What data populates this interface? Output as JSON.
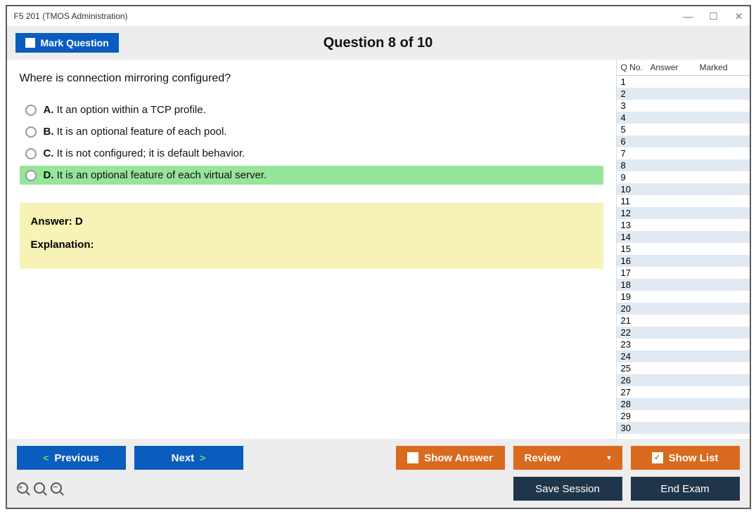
{
  "window": {
    "title": "F5 201 (TMOS Administration)"
  },
  "topbar": {
    "mark_label": "Mark Question",
    "question_title": "Question 8 of 10"
  },
  "question": {
    "text": "Where is connection mirroring configured?",
    "options": [
      {
        "letter": "A.",
        "text": "It an option within a TCP profile.",
        "correct": false
      },
      {
        "letter": "B.",
        "text": "It is an optional feature of each pool.",
        "correct": false
      },
      {
        "letter": "C.",
        "text": "It is not configured; it is default behavior.",
        "correct": false
      },
      {
        "letter": "D.",
        "text": "It is an optional feature of each virtual server.",
        "correct": true
      }
    ]
  },
  "answer_box": {
    "answer_label": "Answer: D",
    "explanation_label": "Explanation:"
  },
  "side_panel": {
    "headers": {
      "qno": "Q No.",
      "answer": "Answer",
      "marked": "Marked"
    },
    "rows": [
      {
        "qno": "1",
        "answer": "",
        "marked": ""
      },
      {
        "qno": "2",
        "answer": "",
        "marked": ""
      },
      {
        "qno": "3",
        "answer": "",
        "marked": ""
      },
      {
        "qno": "4",
        "answer": "",
        "marked": ""
      },
      {
        "qno": "5",
        "answer": "",
        "marked": ""
      },
      {
        "qno": "6",
        "answer": "",
        "marked": ""
      },
      {
        "qno": "7",
        "answer": "",
        "marked": ""
      },
      {
        "qno": "8",
        "answer": "",
        "marked": ""
      },
      {
        "qno": "9",
        "answer": "",
        "marked": ""
      },
      {
        "qno": "10",
        "answer": "",
        "marked": ""
      },
      {
        "qno": "11",
        "answer": "",
        "marked": ""
      },
      {
        "qno": "12",
        "answer": "",
        "marked": ""
      },
      {
        "qno": "13",
        "answer": "",
        "marked": ""
      },
      {
        "qno": "14",
        "answer": "",
        "marked": ""
      },
      {
        "qno": "15",
        "answer": "",
        "marked": ""
      },
      {
        "qno": "16",
        "answer": "",
        "marked": ""
      },
      {
        "qno": "17",
        "answer": "",
        "marked": ""
      },
      {
        "qno": "18",
        "answer": "",
        "marked": ""
      },
      {
        "qno": "19",
        "answer": "",
        "marked": ""
      },
      {
        "qno": "20",
        "answer": "",
        "marked": ""
      },
      {
        "qno": "21",
        "answer": "",
        "marked": ""
      },
      {
        "qno": "22",
        "answer": "",
        "marked": ""
      },
      {
        "qno": "23",
        "answer": "",
        "marked": ""
      },
      {
        "qno": "24",
        "answer": "",
        "marked": ""
      },
      {
        "qno": "25",
        "answer": "",
        "marked": ""
      },
      {
        "qno": "26",
        "answer": "",
        "marked": ""
      },
      {
        "qno": "27",
        "answer": "",
        "marked": ""
      },
      {
        "qno": "28",
        "answer": "",
        "marked": ""
      },
      {
        "qno": "29",
        "answer": "",
        "marked": ""
      },
      {
        "qno": "30",
        "answer": "",
        "marked": ""
      }
    ]
  },
  "bottom": {
    "previous": "Previous",
    "next": "Next",
    "show_answer": "Show Answer",
    "review": "Review",
    "show_list": "Show List",
    "save_session": "Save Session",
    "end_exam": "End Exam"
  }
}
